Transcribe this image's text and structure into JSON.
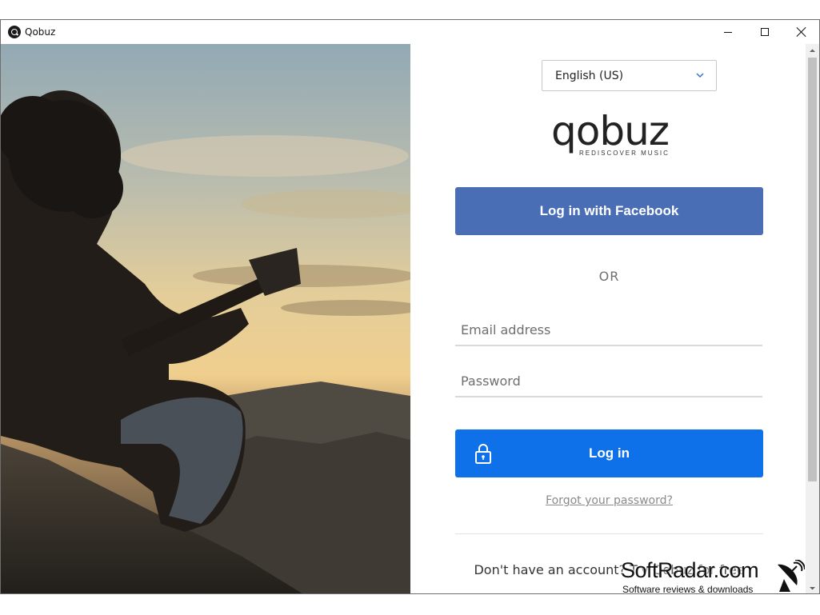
{
  "window": {
    "title": "Qobuz",
    "app_icon": "qobuz-logo-icon",
    "controls": [
      "minimize-icon",
      "maximize-icon",
      "close-icon"
    ]
  },
  "language": {
    "selected": "English (US)",
    "icon": "chevron-down-icon"
  },
  "logo": {
    "wordmark": "qobuz",
    "tagline": "REDISCOVER MUSIC"
  },
  "login": {
    "facebook_label": "Log in with Facebook",
    "or_label": "OR",
    "email_placeholder": "Email address",
    "email_value": "",
    "password_placeholder": "Password",
    "password_value": "",
    "login_label": "Log in",
    "login_icon": "lock-icon",
    "forgot_label": "Forgot your password?",
    "no_account_text": "Don't have an account?",
    "signup_link": "Try Qobuz for free"
  },
  "watermark": {
    "title": "SoftRadar.com",
    "subtitle": "Software reviews & downloads",
    "icon": "satellite-dish-icon"
  },
  "colors": {
    "facebook": "#4a6eb5",
    "login_button": "#0f71ea",
    "muted_text": "#6f6f6f",
    "link": "#8a8a8a"
  }
}
